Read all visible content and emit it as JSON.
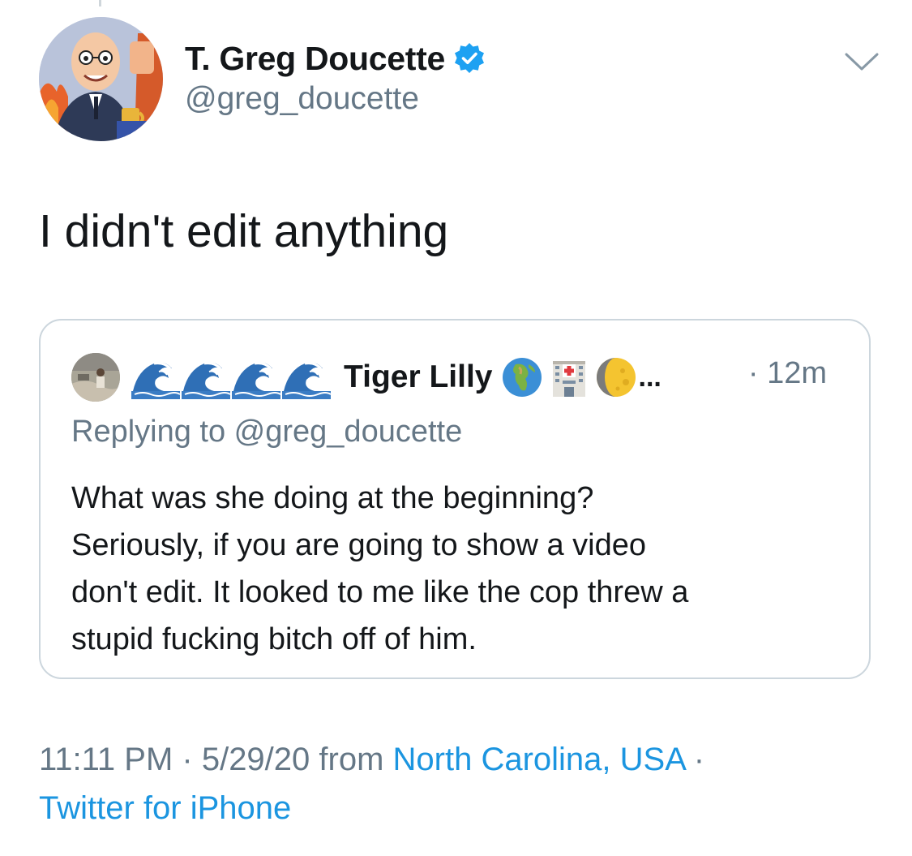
{
  "tweet": {
    "author_name": "T. Greg Doucette",
    "author_handle": "@greg_doucette",
    "verified": true,
    "text": "I didn't edit anything",
    "accent_color": "#1b95e0",
    "secondary_text_color": "#657786"
  },
  "quoted_tweet": {
    "name_prefix_icons": [
      "water-wave-icon",
      "water-wave-icon",
      "water-wave-icon",
      "water-wave-icon"
    ],
    "author_name": "Tiger Lilly",
    "name_suffix_icons": [
      "globe-africa-icon",
      "hospital-icon",
      "moon-icon"
    ],
    "name_ellipsis": "...",
    "time": "· 12m",
    "reply_prefix": "Replying to ",
    "reply_handle": "@greg_doucette",
    "text_lines": [
      "What was she doing at the beginning?",
      "Seriously, if you are going to show a video",
      "don't edit. It looked to me like the cop threw a",
      "stupid fucking bitch off of him."
    ]
  },
  "footer": {
    "time": "11:11 PM",
    "separator1": " · ",
    "date": "5/29/20",
    "from_label": " from ",
    "location": "North Carolina, USA",
    "separator2": " ·",
    "source": "Twitter for iPhone"
  }
}
